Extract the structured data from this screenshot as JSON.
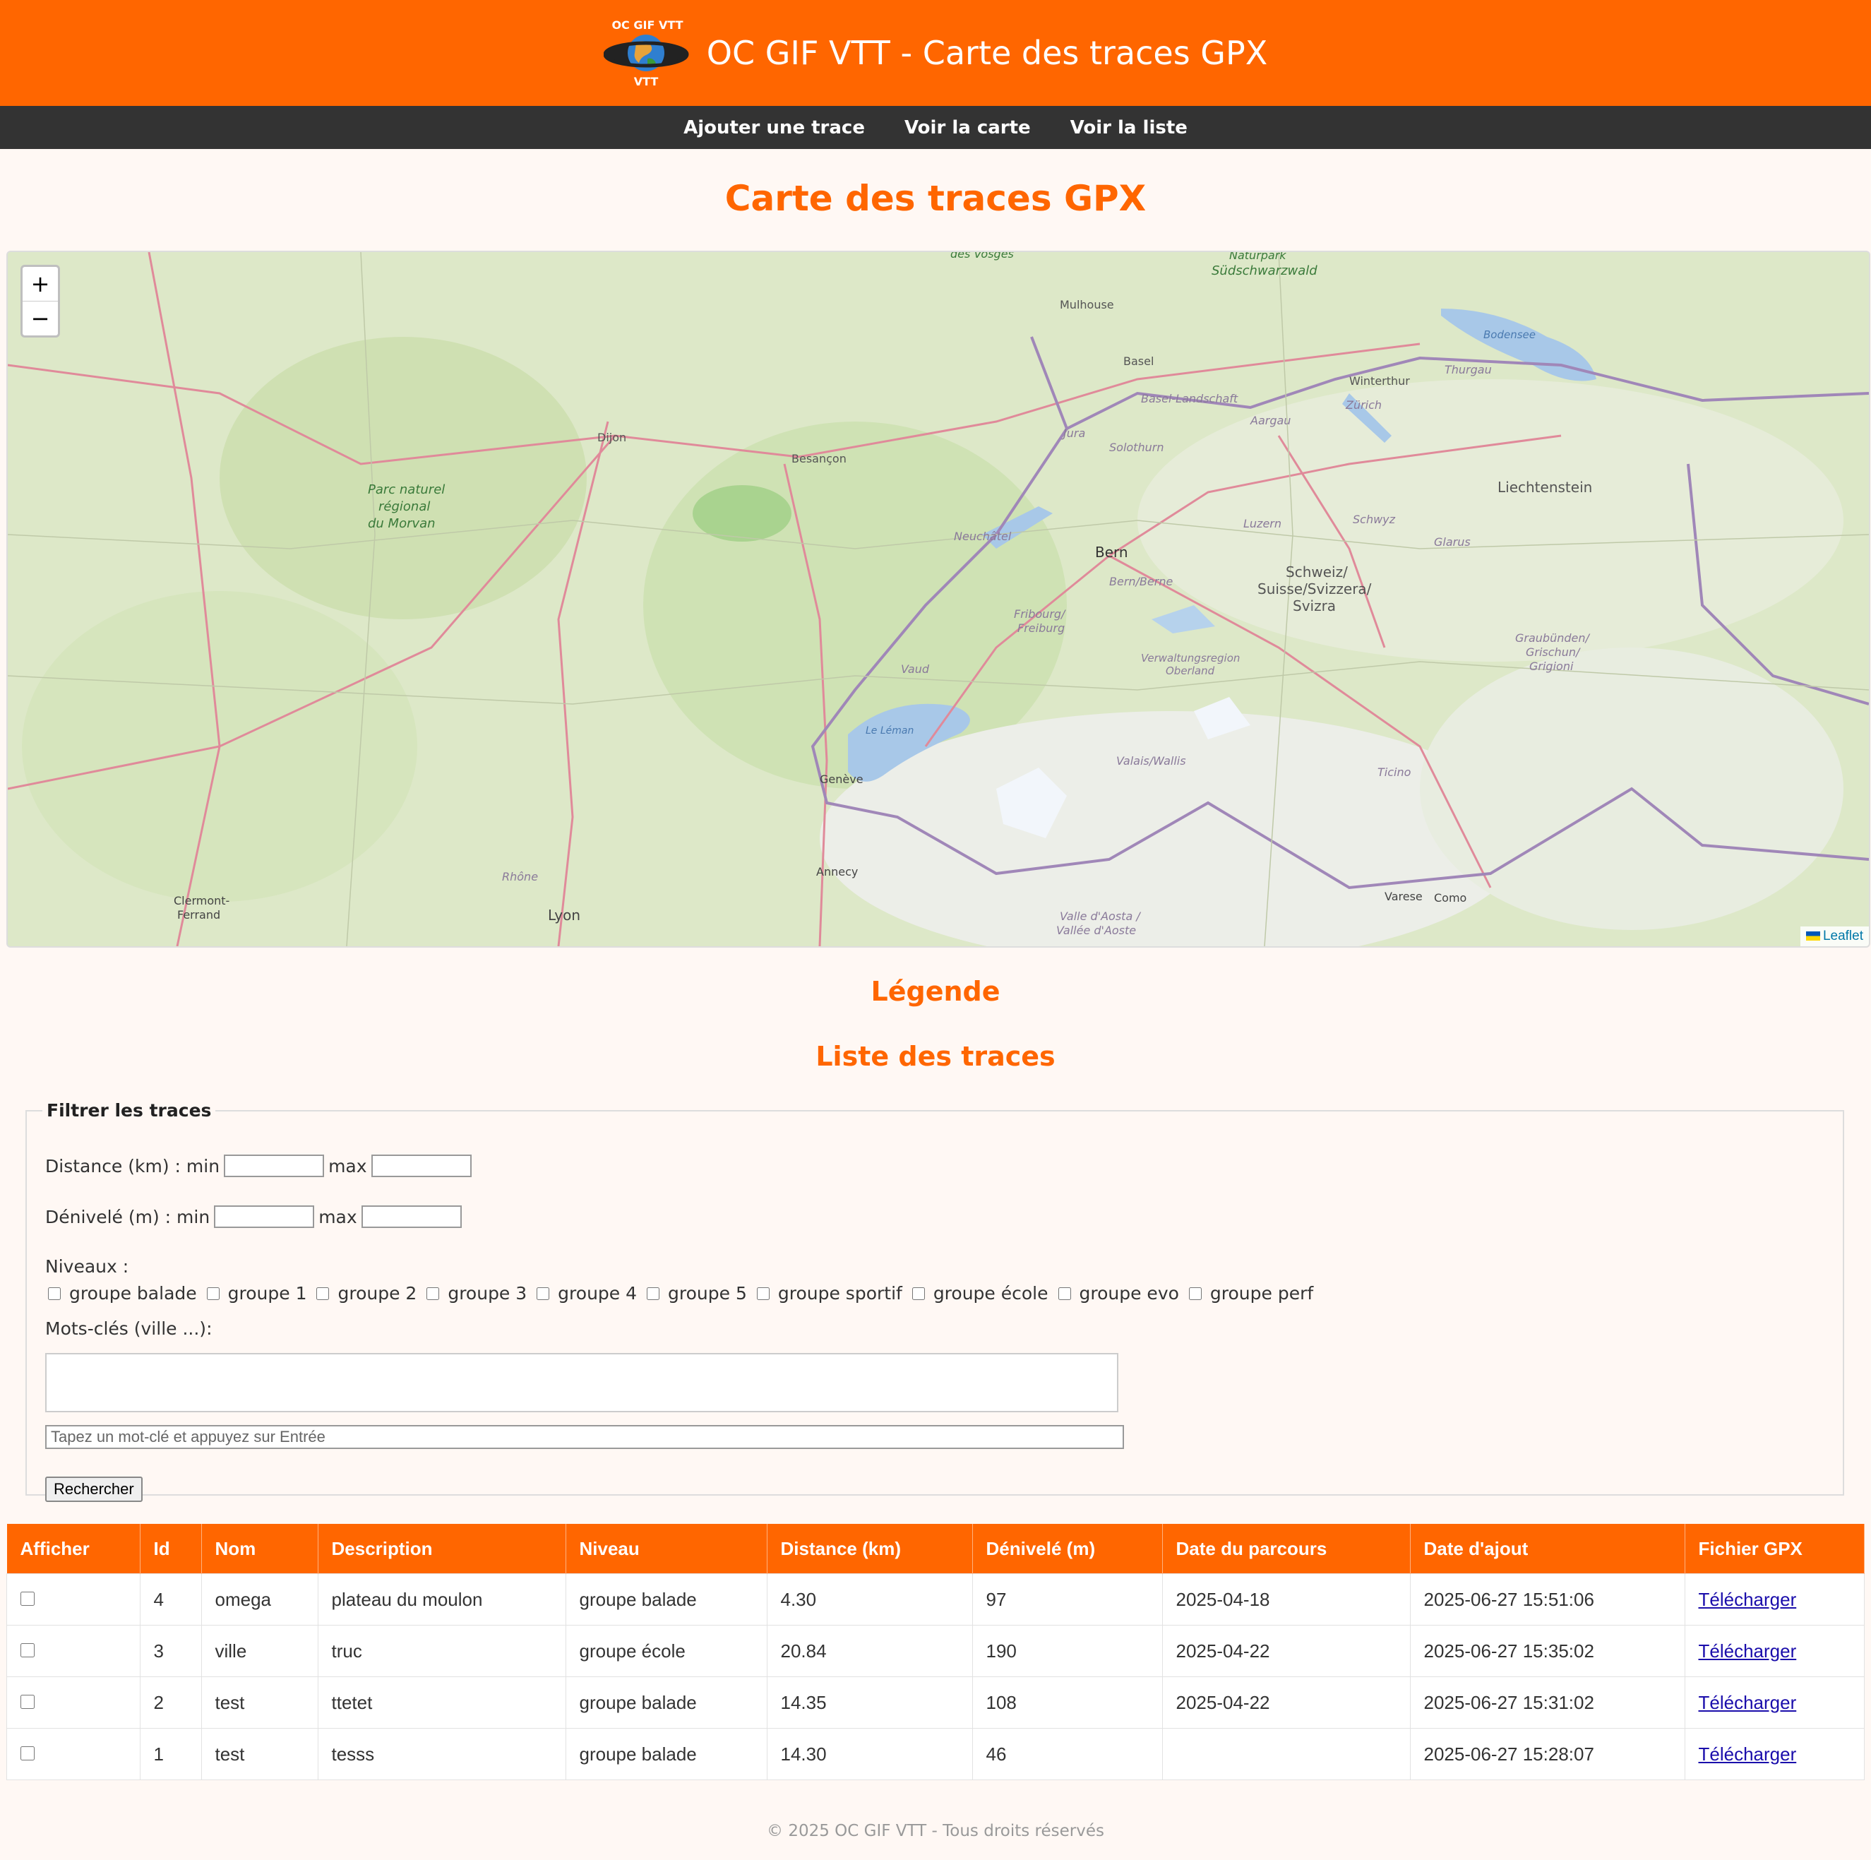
{
  "header": {
    "title": "OC GIF VTT - Carte des traces GPX",
    "logo_text": "OC GIF VTT"
  },
  "nav": [
    {
      "label": "Ajouter une trace"
    },
    {
      "label": "Voir la carte"
    },
    {
      "label": "Voir la liste"
    }
  ],
  "page": {
    "title": "Carte des traces GPX"
  },
  "map": {
    "zoom_in": "+",
    "zoom_out": "−",
    "attribution": "Leaflet",
    "labels": {
      "dijon": "Dijon",
      "besancon": "Besançon",
      "mulhouse": "Mulhouse",
      "basel": "Basel",
      "basel_landschaft": "Basel-Landschaft",
      "zurich": "Zürich",
      "winterthur": "Winterthur",
      "bern": "Bern",
      "bern_berne": "Bern/Berne",
      "luzern": "Luzern",
      "liechtenstein": "Liechtenstein",
      "schweiz": "Schweiz/",
      "schweiz2": "Suisse/Svizzera/",
      "schweiz3": "Svizra",
      "neuchatel": "Neuchâtel",
      "geneve": "Genève",
      "lausanne_lake": "Le Léman",
      "lyon": "Lyon",
      "annecy": "Annecy",
      "clermont": "Clermont-",
      "clermont2": "Ferrand",
      "morvan": "Parc naturel",
      "morvan2": "régional",
      "morvan3": "du Morvan",
      "vosges": "des Vosges",
      "sudschwarzwald": "Naturpark",
      "sudschwarzwald2": "Südschwarzwald",
      "ticino": "Ticino",
      "valais": "Valais/Wallis",
      "graubunden": "Graubünden/",
      "graubunden2": "Grischun/",
      "graubunden3": "Grigioni",
      "aargau": "Aargau",
      "solothurn": "Solothurn",
      "jura": "Jura",
      "thurgau": "Thurgau",
      "schwyz": "Schwyz",
      "glarus": "Glarus",
      "fribourg": "Fribourg/",
      "fribourg2": "Freiburg",
      "vaud": "Vaud",
      "oberland": "Verwaltungsregion",
      "oberland2": "Oberland",
      "varese": "Varese",
      "como": "Como",
      "aosta": "Valle d'Aosta /",
      "aosta2": "Vallée d'Aoste",
      "rhone": "Rhône",
      "bodensee": "Bodensee"
    }
  },
  "sections": {
    "legend": "Légende",
    "list": "Liste des traces"
  },
  "filters": {
    "legend": "Filtrer les traces",
    "distance_label": "Distance (km) : min",
    "denivele_label": "Dénivelé (m) : min",
    "max_label": "max",
    "levels_label": "Niveaux :",
    "levels": [
      "groupe balade",
      "groupe 1",
      "groupe 2",
      "groupe 3",
      "groupe 4",
      "groupe 5",
      "groupe sportif",
      "groupe école",
      "groupe evo",
      "groupe perf"
    ],
    "keywords_label": "Mots-clés (ville ...):",
    "keywords_placeholder": "Tapez un mot-clé et appuyez sur Entrée",
    "search_button": "Rechercher"
  },
  "table": {
    "columns": [
      "Afficher",
      "Id",
      "Nom",
      "Description",
      "Niveau",
      "Distance (km)",
      "Dénivelé (m)",
      "Date du parcours",
      "Date d'ajout",
      "Fichier GPX"
    ],
    "rows": [
      {
        "id": "4",
        "nom": "omega",
        "description": "plateau du moulon",
        "niveau": "groupe balade",
        "distance": "4.30",
        "denivele": "97",
        "date_parcours": "2025-04-18",
        "date_ajout": "2025-06-27 15:51:06",
        "fichier": "Télécharger"
      },
      {
        "id": "3",
        "nom": "ville",
        "description": "truc",
        "niveau": "groupe école",
        "distance": "20.84",
        "denivele": "190",
        "date_parcours": "2025-04-22",
        "date_ajout": "2025-06-27 15:35:02",
        "fichier": "Télécharger"
      },
      {
        "id": "2",
        "nom": "test",
        "description": "ttetet",
        "niveau": "groupe balade",
        "distance": "14.35",
        "denivele": "108",
        "date_parcours": "2025-04-22",
        "date_ajout": "2025-06-27 15:31:02",
        "fichier": "Télécharger"
      },
      {
        "id": "1",
        "nom": "test",
        "description": "tesss",
        "niveau": "groupe balade",
        "distance": "14.30",
        "denivele": "46",
        "date_parcours": "",
        "date_ajout": "2025-06-27 15:28:07",
        "fichier": "Télécharger"
      }
    ]
  },
  "footer": {
    "text": "© 2025 OC GIF VTT - Tous droits réservés"
  },
  "colors": {
    "brand": "#ff6600",
    "nav": "#333333",
    "background": "#fff8f4"
  }
}
